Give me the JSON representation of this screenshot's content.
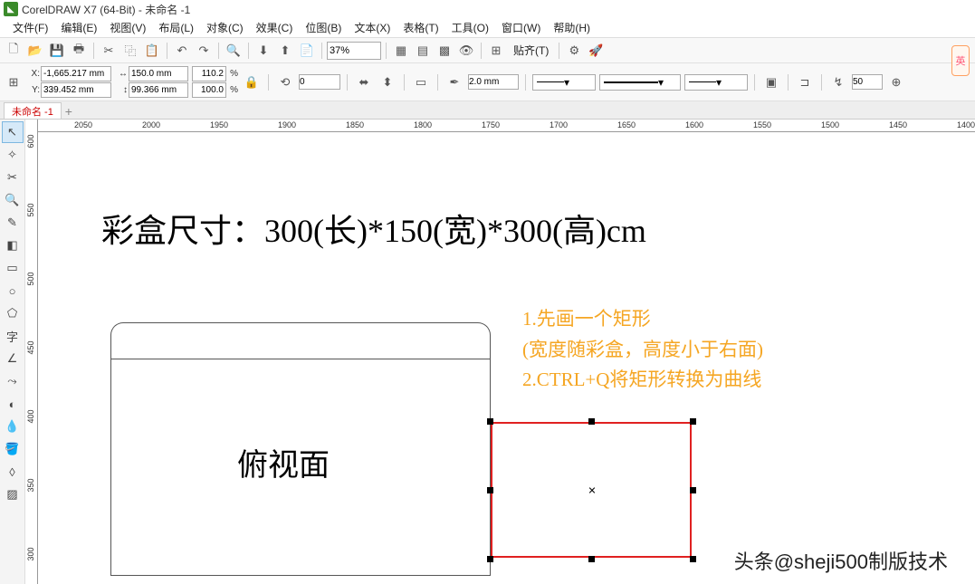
{
  "title": "CorelDRAW X7 (64-Bit) - 未命名 -1",
  "menu": [
    "文件(F)",
    "编辑(E)",
    "视图(V)",
    "布局(L)",
    "对象(C)",
    "效果(C)",
    "位图(B)",
    "文本(X)",
    "表格(T)",
    "工具(O)",
    "窗口(W)",
    "帮助(H)"
  ],
  "zoom": "37%",
  "snap": "贴齐(T)",
  "coords": {
    "x": "-1,665.217 mm",
    "y": "339.452 mm"
  },
  "size": {
    "w": "150.0 mm",
    "h": "99.366 mm"
  },
  "scale": {
    "sx": "110.2",
    "sy": "100.0"
  },
  "rot": "0",
  "outline_width": "2.0 mm",
  "spin": "50",
  "doc_tab": "未命名 -1",
  "hruler": [
    "2050",
    "2000",
    "1950",
    "1900",
    "1850",
    "1800",
    "1750",
    "1700",
    "1650",
    "1600",
    "1550",
    "1500",
    "1450",
    "1400"
  ],
  "vruler": [
    "600",
    "550",
    "500",
    "450",
    "400",
    "350",
    "300"
  ],
  "canvas": {
    "heading": "彩盒尺寸：300(长)*150(宽)*300(高)cm",
    "face": "俯视面",
    "notes": "1.先画一个矩形\n(宽度随彩盒，高度小于右面)\n 2.CTRL+Q将矩形转换为曲线"
  },
  "watermark": "头条@sheji500制版技术",
  "ime": "英"
}
